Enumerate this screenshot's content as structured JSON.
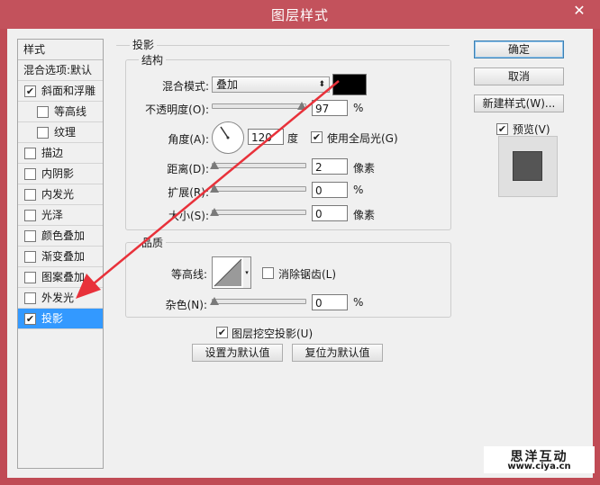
{
  "window": {
    "title": "图层样式",
    "close": "✕"
  },
  "styles_list": {
    "header": "样式",
    "items": [
      {
        "label": "混合选项:默认",
        "checkbox": false,
        "checked": false,
        "indent": false,
        "selected": false
      },
      {
        "label": "斜面和浮雕",
        "checkbox": true,
        "checked": true,
        "indent": false,
        "selected": false
      },
      {
        "label": "等高线",
        "checkbox": true,
        "checked": false,
        "indent": true,
        "selected": false
      },
      {
        "label": "纹理",
        "checkbox": true,
        "checked": false,
        "indent": true,
        "selected": false
      },
      {
        "label": "描边",
        "checkbox": true,
        "checked": false,
        "indent": false,
        "selected": false
      },
      {
        "label": "内阴影",
        "checkbox": true,
        "checked": false,
        "indent": false,
        "selected": false
      },
      {
        "label": "内发光",
        "checkbox": true,
        "checked": false,
        "indent": false,
        "selected": false
      },
      {
        "label": "光泽",
        "checkbox": true,
        "checked": false,
        "indent": false,
        "selected": false
      },
      {
        "label": "颜色叠加",
        "checkbox": true,
        "checked": false,
        "indent": false,
        "selected": false
      },
      {
        "label": "渐变叠加",
        "checkbox": true,
        "checked": false,
        "indent": false,
        "selected": false
      },
      {
        "label": "图案叠加",
        "checkbox": true,
        "checked": false,
        "indent": false,
        "selected": false
      },
      {
        "label": "外发光",
        "checkbox": true,
        "checked": false,
        "indent": false,
        "selected": false
      },
      {
        "label": "投影",
        "checkbox": true,
        "checked": true,
        "indent": false,
        "selected": true
      }
    ]
  },
  "drop_shadow": {
    "section_title": "投影",
    "structure": {
      "title": "结构",
      "blend_mode_label": "混合模式:",
      "blend_mode_value": "叠加",
      "color": "#000000",
      "opacity_label": "不透明度(O):",
      "opacity_value": "97",
      "opacity_unit": "%",
      "opacity_level": 0.97,
      "angle_label": "角度(A):",
      "angle_value": "120",
      "angle_unit": "度",
      "use_global_light": "使用全局光(G)",
      "use_global_light_checked": true,
      "distance_label": "距离(D):",
      "distance_value": "2",
      "distance_unit": "像素",
      "spread_label": "扩展(R):",
      "spread_value": "0",
      "spread_unit": "%",
      "size_label": "大小(S):",
      "size_value": "0",
      "size_unit": "像素"
    },
    "quality": {
      "title": "品质",
      "contour_label": "等高线:",
      "anti_aliased": "消除锯齿(L)",
      "anti_aliased_checked": false,
      "noise_label": "杂色(N):",
      "noise_value": "0",
      "noise_unit": "%"
    },
    "knockout": "图层挖空投影(U)",
    "knockout_checked": true,
    "make_default": "设置为默认值",
    "reset_default": "复位为默认值"
  },
  "buttons": {
    "ok": "确定",
    "cancel": "取消",
    "new_style": "新建样式(W)...",
    "preview": "预览(V)",
    "preview_checked": true
  },
  "watermark": {
    "text": "思洋互动",
    "url": "www.ciya.cn"
  },
  "colors": {
    "title_bar": "#c3525c",
    "selection": "#3399ff",
    "arrow": "#e8313a"
  }
}
